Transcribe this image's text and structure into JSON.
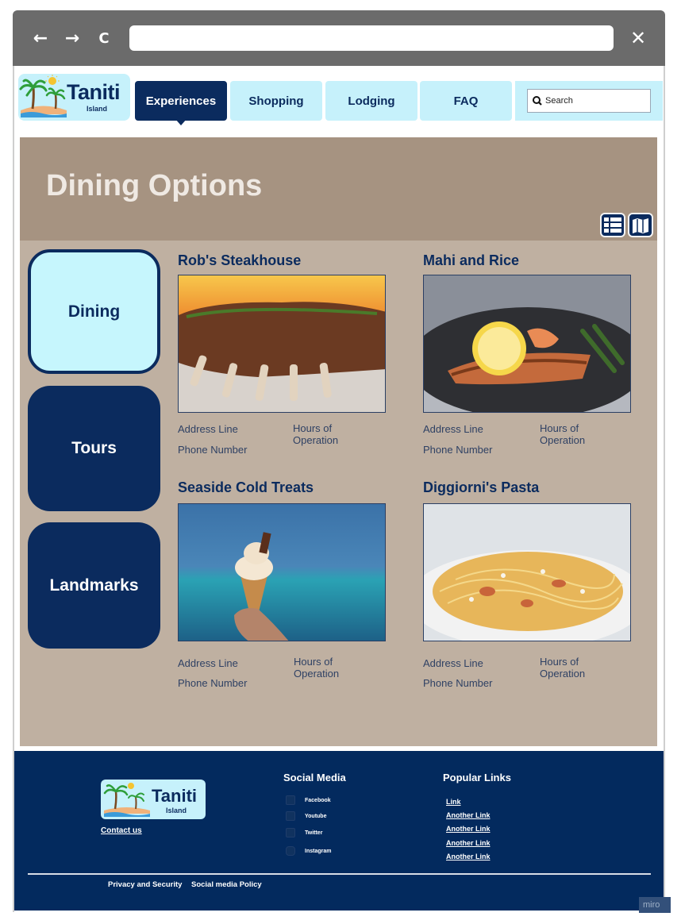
{
  "browser": {
    "back_icon": "←",
    "forward_icon": "→",
    "reload_icon": "C",
    "close_icon": "✕"
  },
  "logo": {
    "title": "Taniti",
    "subtitle": "Island"
  },
  "nav": {
    "tabs": [
      {
        "label": "Experiences",
        "active": true
      },
      {
        "label": "Shopping"
      },
      {
        "label": "Lodging"
      },
      {
        "label": "FAQ"
      }
    ],
    "search_placeholder": "Search"
  },
  "hero": {
    "title": "Dining Options"
  },
  "categories": [
    {
      "label": "Dining",
      "active": true
    },
    {
      "label": "Tours"
    },
    {
      "label": "Landmarks"
    }
  ],
  "restaurants": [
    {
      "name": "Rob's Steakhouse",
      "address": "Address Line",
      "phone": "Phone Number",
      "hours": "Hours of Operation"
    },
    {
      "name": "Mahi and Rice",
      "address": "Address Line",
      "phone": "Phone Number",
      "hours": "Hours of Operation"
    },
    {
      "name": "Seaside Cold Treats",
      "address": "Address Line",
      "phone": "Phone Number",
      "hours": "Hours of Operation"
    },
    {
      "name": "Diggiorni's Pasta",
      "address": "Address Line",
      "phone": "Phone Number",
      "hours": "Hours of Operation"
    }
  ],
  "footer": {
    "logo_title": "Taniti",
    "logo_subtitle": "Island",
    "contact": "Contact us",
    "social_heading": "Social Media",
    "social": [
      "Facebook",
      "Youtube",
      "Twitter",
      "Instagram"
    ],
    "popular_heading": "Popular Links",
    "links": [
      "Link",
      "Another Link",
      "Another Link",
      "Another Link",
      "Another Link"
    ],
    "privacy": "Privacy and Security",
    "social_policy": "Social media Policy"
  },
  "watermark": "miro",
  "colors": {
    "navy": "#0b2b5e",
    "light_blue": "#c6f1fb",
    "hero_brown": "#a69381",
    "content_tan": "#bfb0a1"
  }
}
